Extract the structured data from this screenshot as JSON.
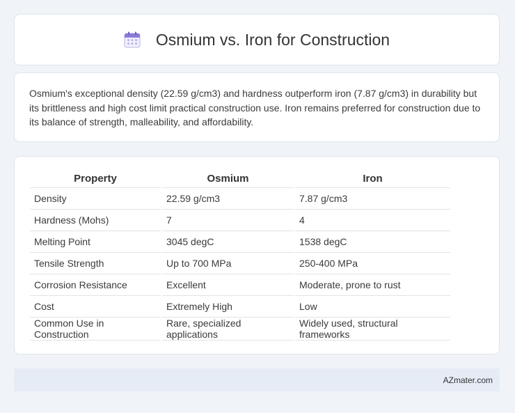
{
  "header": {
    "icon": "calendar-icon",
    "title": "Osmium vs. Iron for Construction"
  },
  "summary": {
    "text": "Osmium's exceptional density (22.59 g/cm3) and hardness outperform iron (7.87 g/cm3) in durability but its brittleness and high cost limit practical construction use. Iron remains preferred for construction due to its balance of strength, malleability, and affordability."
  },
  "table": {
    "headers": [
      "Property",
      "Osmium",
      "Iron"
    ],
    "rows": [
      [
        "Density",
        "22.59 g/cm3",
        "7.87 g/cm3"
      ],
      [
        "Hardness (Mohs)",
        "7",
        "4"
      ],
      [
        "Melting Point",
        "3045 degC",
        "1538 degC"
      ],
      [
        "Tensile Strength",
        "Up to 700 MPa",
        "250-400 MPa"
      ],
      [
        "Corrosion Resistance",
        "Excellent",
        "Moderate, prone to rust"
      ],
      [
        "Cost",
        "Extremely High",
        "Low"
      ],
      [
        "Common Use in Construction",
        "Rare, specialized applications",
        "Widely used, structural frameworks"
      ]
    ]
  },
  "footer": {
    "brand": "AZmater.com"
  },
  "colors": {
    "background": "#f0f3f8",
    "card": "#ffffff",
    "footer": "#e6ecf6",
    "icon_accent": "#8c7bd8"
  }
}
